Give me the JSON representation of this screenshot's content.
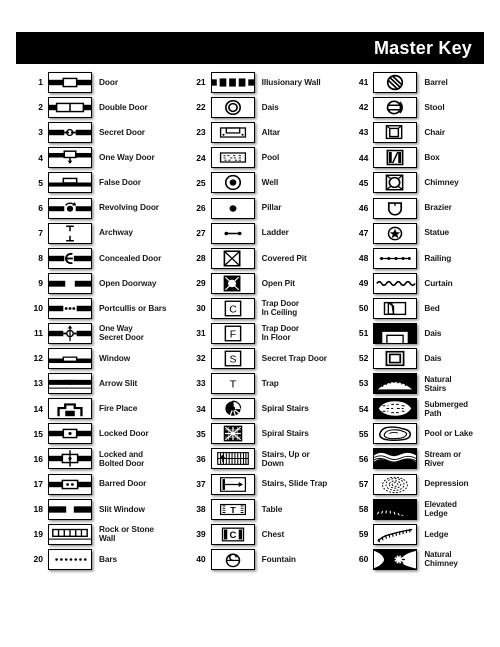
{
  "header": {
    "title": "Master Key",
    "bar_color": "#000000",
    "text_color": "#ffffff"
  },
  "page": {
    "background": "#ffffff",
    "ink": "#000000"
  },
  "columns": [
    {
      "name": "column-1",
      "entries": [
        {
          "num": "1",
          "label": "Door",
          "icon": "door"
        },
        {
          "num": "2",
          "label": "Double Door",
          "icon": "double-door"
        },
        {
          "num": "3",
          "label": "Secret Door",
          "icon": "secret-door"
        },
        {
          "num": "4",
          "label": "One Way Door",
          "icon": "one-way-door"
        },
        {
          "num": "5",
          "label": "False Door",
          "icon": "false-door"
        },
        {
          "num": "6",
          "label": "Revolving Door",
          "icon": "revolving-door"
        },
        {
          "num": "7",
          "label": "Archway",
          "icon": "archway"
        },
        {
          "num": "8",
          "label": "Concealed Door",
          "icon": "concealed-door"
        },
        {
          "num": "9",
          "label": "Open Doorway",
          "icon": "open-doorway"
        },
        {
          "num": "10",
          "label": "Portcullis or Bars",
          "icon": "portcullis"
        },
        {
          "num": "11",
          "label": "One Way\nSecret Door",
          "icon": "one-way-secret-door"
        },
        {
          "num": "12",
          "label": "Window",
          "icon": "window"
        },
        {
          "num": "13",
          "label": "Arrow Slit",
          "icon": "arrow-slit"
        },
        {
          "num": "14",
          "label": "Fire Place",
          "icon": "fire-place"
        },
        {
          "num": "15",
          "label": "Locked Door",
          "icon": "locked-door"
        },
        {
          "num": "16",
          "label": "Locked and\nBolted Door",
          "icon": "locked-bolted-door"
        },
        {
          "num": "17",
          "label": "Barred Door",
          "icon": "barred-door"
        },
        {
          "num": "18",
          "label": "Slit Window",
          "icon": "slit-window"
        },
        {
          "num": "19",
          "label": "Rock or Stone Wall",
          "icon": "rock-stone-wall"
        },
        {
          "num": "20",
          "label": "Bars",
          "icon": "bars"
        }
      ]
    },
    {
      "name": "column-2",
      "entries": [
        {
          "num": "21",
          "label": "Illusionary Wall",
          "icon": "illusionary-wall"
        },
        {
          "num": "22",
          "label": "Dais",
          "icon": "dais-circle"
        },
        {
          "num": "23",
          "label": "Altar",
          "icon": "altar"
        },
        {
          "num": "24",
          "label": "Pool",
          "icon": "pool"
        },
        {
          "num": "25",
          "label": "Well",
          "icon": "well"
        },
        {
          "num": "26",
          "label": "Pillar",
          "icon": "pillar"
        },
        {
          "num": "27",
          "label": "Ladder",
          "icon": "ladder"
        },
        {
          "num": "28",
          "label": "Covered Pit",
          "icon": "covered-pit"
        },
        {
          "num": "29",
          "label": "Open Pit",
          "icon": "open-pit"
        },
        {
          "num": "30",
          "label": "Trap Door\nIn Ceiling",
          "icon": "trap-door-ceiling"
        },
        {
          "num": "31",
          "label": "Trap Door\nIn Floor",
          "icon": "trap-door-floor"
        },
        {
          "num": "32",
          "label": "Secret Trap Door",
          "icon": "secret-trap-door"
        },
        {
          "num": "33",
          "label": "Trap",
          "icon": "trap"
        },
        {
          "num": "34",
          "label": "Spiral Stairs",
          "icon": "spiral-stairs-a"
        },
        {
          "num": "35",
          "label": "Spiral Stairs",
          "icon": "spiral-stairs-b"
        },
        {
          "num": "36",
          "label": "Stairs, Up or Down",
          "icon": "stairs-up-down"
        },
        {
          "num": "37",
          "label": "Stairs, Slide Trap",
          "icon": "stairs-slide-trap"
        },
        {
          "num": "38",
          "label": "Table",
          "icon": "table"
        },
        {
          "num": "39",
          "label": "Chest",
          "icon": "chest"
        },
        {
          "num": "40",
          "label": "Fountain",
          "icon": "fountain"
        }
      ]
    },
    {
      "name": "column-3",
      "entries": [
        {
          "num": "41",
          "label": "Barrel",
          "icon": "barrel"
        },
        {
          "num": "42",
          "label": "Stool",
          "icon": "stool"
        },
        {
          "num": "43",
          "label": "Chair",
          "icon": "chair"
        },
        {
          "num": "44",
          "label": "Box",
          "icon": "box"
        },
        {
          "num": "45",
          "label": "Chimney",
          "icon": "chimney"
        },
        {
          "num": "46",
          "label": "Brazier",
          "icon": "brazier"
        },
        {
          "num": "47",
          "label": "Statue",
          "icon": "statue"
        },
        {
          "num": "48",
          "label": "Railing",
          "icon": "railing"
        },
        {
          "num": "49",
          "label": "Curtain",
          "icon": "curtain"
        },
        {
          "num": "50",
          "label": "Bed",
          "icon": "bed"
        },
        {
          "num": "51",
          "label": "Dais",
          "icon": "dais-step"
        },
        {
          "num": "52",
          "label": "Dais",
          "icon": "dais-square"
        },
        {
          "num": "53",
          "label": "Natural\nStairs",
          "icon": "natural-stairs"
        },
        {
          "num": "54",
          "label": "Submerged\nPath",
          "icon": "submerged-path"
        },
        {
          "num": "55",
          "label": "Pool or Lake",
          "icon": "pool-or-lake"
        },
        {
          "num": "56",
          "label": "Stream or\nRiver",
          "icon": "stream-or-river"
        },
        {
          "num": "57",
          "label": "Depression",
          "icon": "depression"
        },
        {
          "num": "58",
          "label": "Elevated\nLedge",
          "icon": "elevated-ledge"
        },
        {
          "num": "59",
          "label": "Ledge",
          "icon": "ledge"
        },
        {
          "num": "60",
          "label": "Natural\nChimney",
          "icon": "natural-chimney"
        }
      ]
    }
  ]
}
